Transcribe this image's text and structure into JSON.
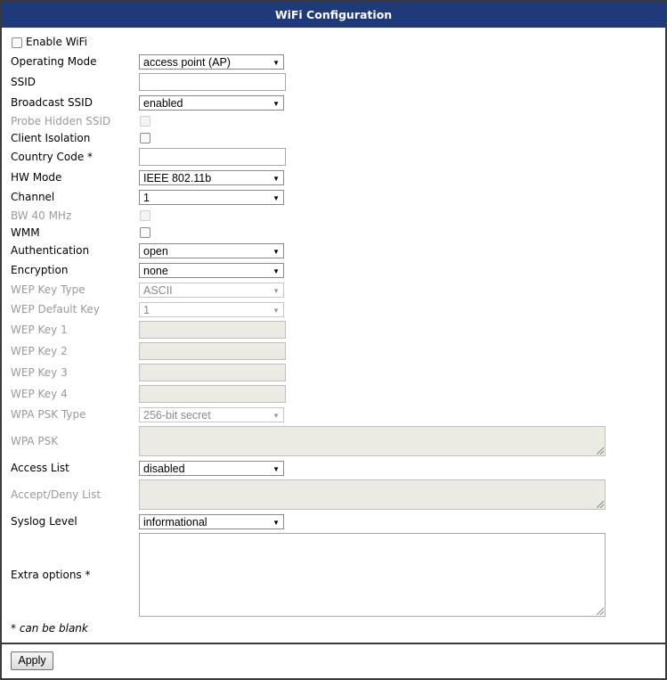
{
  "title": "WiFi Configuration",
  "enable_wifi": "Enable WiFi",
  "labels": {
    "operating_mode": "Operating Mode",
    "ssid": "SSID",
    "broadcast_ssid": "Broadcast SSID",
    "probe_hidden_ssid": "Probe Hidden SSID",
    "client_isolation": "Client Isolation",
    "country_code": "Country Code *",
    "hw_mode": "HW Mode",
    "channel": "Channel",
    "bw40": "BW 40 MHz",
    "wmm": "WMM",
    "authentication": "Authentication",
    "encryption": "Encryption",
    "wep_key_type": "WEP Key Type",
    "wep_default_key": "WEP Default Key",
    "wep_key1": "WEP Key 1",
    "wep_key2": "WEP Key 2",
    "wep_key3": "WEP Key 3",
    "wep_key4": "WEP Key 4",
    "wpa_psk_type": "WPA PSK Type",
    "wpa_psk": "WPA PSK",
    "access_list": "Access List",
    "accept_deny_list": "Accept/Deny List",
    "syslog_level": "Syslog Level",
    "extra_options": "Extra options *"
  },
  "values": {
    "operating_mode": "access point (AP)",
    "broadcast_ssid": "enabled",
    "hw_mode": "IEEE 802.11b",
    "channel": "1",
    "authentication": "open",
    "encryption": "none",
    "wep_key_type": "ASCII",
    "wep_default_key": "1",
    "wpa_psk_type": "256-bit secret",
    "access_list": "disabled",
    "syslog_level": "informational"
  },
  "note": "* can be blank",
  "apply_label": "Apply",
  "icons": {
    "dropdown": "triangle-down-icon",
    "resize": "resize-grip-icon"
  }
}
